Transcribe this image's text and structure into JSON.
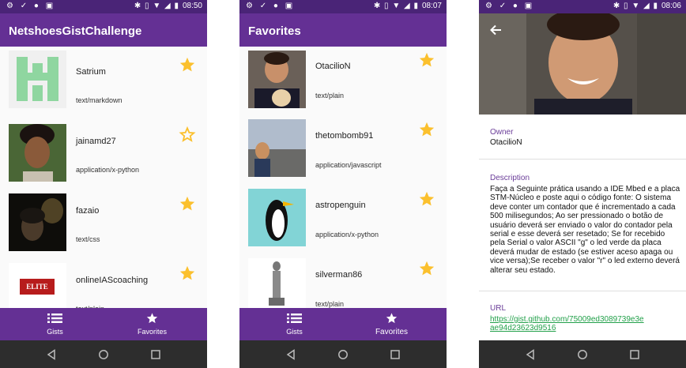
{
  "status_left": "⚙ ✓ ● ▣",
  "screen1": {
    "time": "08:50",
    "title": "NetshoesGistChallenge",
    "items": [
      {
        "name": "Satrium",
        "type": "text/markdown",
        "favorite": true
      },
      {
        "name": "jainamd27",
        "type": "application/x-python",
        "favorite": false
      },
      {
        "name": "fazaio",
        "type": "text/css",
        "favorite": true
      },
      {
        "name": "onlineIAScoaching",
        "type": "text/plain",
        "favorite": true
      }
    ],
    "avatar4_text": "ELITE IAS"
  },
  "screen2": {
    "time": "08:07",
    "title": "Favorites",
    "items": [
      {
        "name": "OtacilioN",
        "type": "text/plain",
        "favorite": true
      },
      {
        "name": "thetombomb91",
        "type": "application/javascript",
        "favorite": true
      },
      {
        "name": "astropenguin",
        "type": "application/x-python",
        "favorite": true
      },
      {
        "name": "silverman86",
        "type": "text/plain",
        "favorite": true
      }
    ]
  },
  "screen3": {
    "time": "08:06",
    "owner_label": "Owner",
    "owner": "OtacilioN",
    "description_label": "Description",
    "description": "Faça a Seguinte prática usando a IDE Mbed e a placa STM-Núcleo e poste aqui o código fonte: O sistema deve conter um contador que é incrementado a cada 500 milisegundos; Ao ser pressionado o botão de usuário deverá ser enviado o valor do contador pela serial e esse deverá ser resetado; Se for recebido pela Serial o valor ASCII \"g\" o led verde da placa deverá mudar de estado (se estiver aceso apaga ou vice versa);Se receber o valor \"r\" o led externo deverá alterar seu estado.",
    "url_label": "URL",
    "url": "https://gist.github.com/75009ed3089739e3eae94d23623d9516"
  },
  "nav": {
    "gists": "Gists",
    "favorites": "Favorites"
  },
  "colors": {
    "primary": "#643094",
    "status": "#4a2477",
    "star": "#fbc02d",
    "link": "#22a04a"
  }
}
